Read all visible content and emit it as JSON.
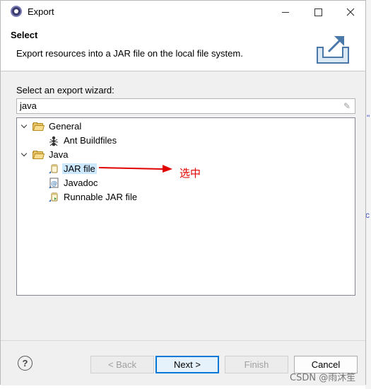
{
  "window": {
    "title": "Export"
  },
  "banner": {
    "title": "Select",
    "description": "Export resources into a JAR file on the local file system."
  },
  "wizard": {
    "label": "Select an export wizard:",
    "filter_value": "java",
    "tree": [
      {
        "label": "General",
        "type": "folder",
        "expanded": true,
        "children": [
          {
            "label": "Ant Buildfiles",
            "icon": "ant-icon"
          }
        ]
      },
      {
        "label": "Java",
        "type": "folder",
        "expanded": true,
        "children": [
          {
            "label": "JAR file",
            "icon": "jar-file-icon",
            "selected": true
          },
          {
            "label": "Javadoc",
            "icon": "javadoc-icon"
          },
          {
            "label": "Runnable JAR file",
            "icon": "runnable-jar-icon"
          }
        ]
      }
    ]
  },
  "annotation": {
    "text": "选中",
    "color": "#e00000"
  },
  "buttons": {
    "help": "?",
    "back": "< Back",
    "next": "Next >",
    "finish": "Finish",
    "cancel": "Cancel"
  },
  "watermark": "CSDN @雨沐笙"
}
